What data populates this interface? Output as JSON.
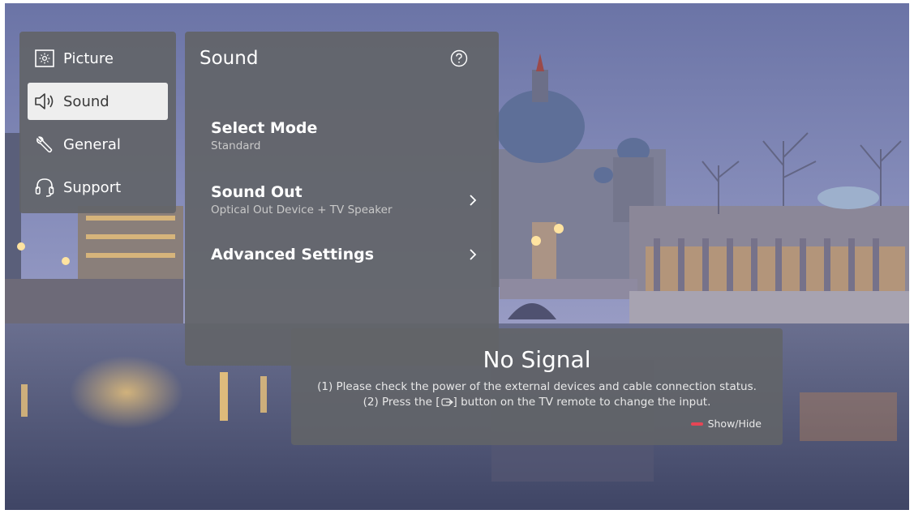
{
  "categories": [
    {
      "label": "Picture",
      "icon": "picture-icon",
      "active": false
    },
    {
      "label": "Sound",
      "icon": "speaker-icon",
      "active": true
    },
    {
      "label": "General",
      "icon": "wrench-icon",
      "active": false
    },
    {
      "label": "Support",
      "icon": "headset-icon",
      "active": false
    }
  ],
  "panel": {
    "title": "Sound",
    "help_icon": "help-icon",
    "items": [
      {
        "label": "Select Mode",
        "value": "Standard"
      },
      {
        "label": "Sound Out",
        "value": "Optical Out Device + TV Speaker"
      },
      {
        "label": "Advanced Settings"
      }
    ]
  },
  "no_signal": {
    "title": "No Signal",
    "line1": "(1) Please check the power of the external devices and cable connection status.",
    "line2_prefix": "(2) Press the [",
    "line2_suffix": "] button on the TV remote to change the input.",
    "input_icon": "input-source-icon",
    "toggle_label": "Show/Hide",
    "toggle_color": "#e64555"
  },
  "colors": {
    "panel": "#626468",
    "active_item": "#eeeeee",
    "text": "#ffffff"
  }
}
